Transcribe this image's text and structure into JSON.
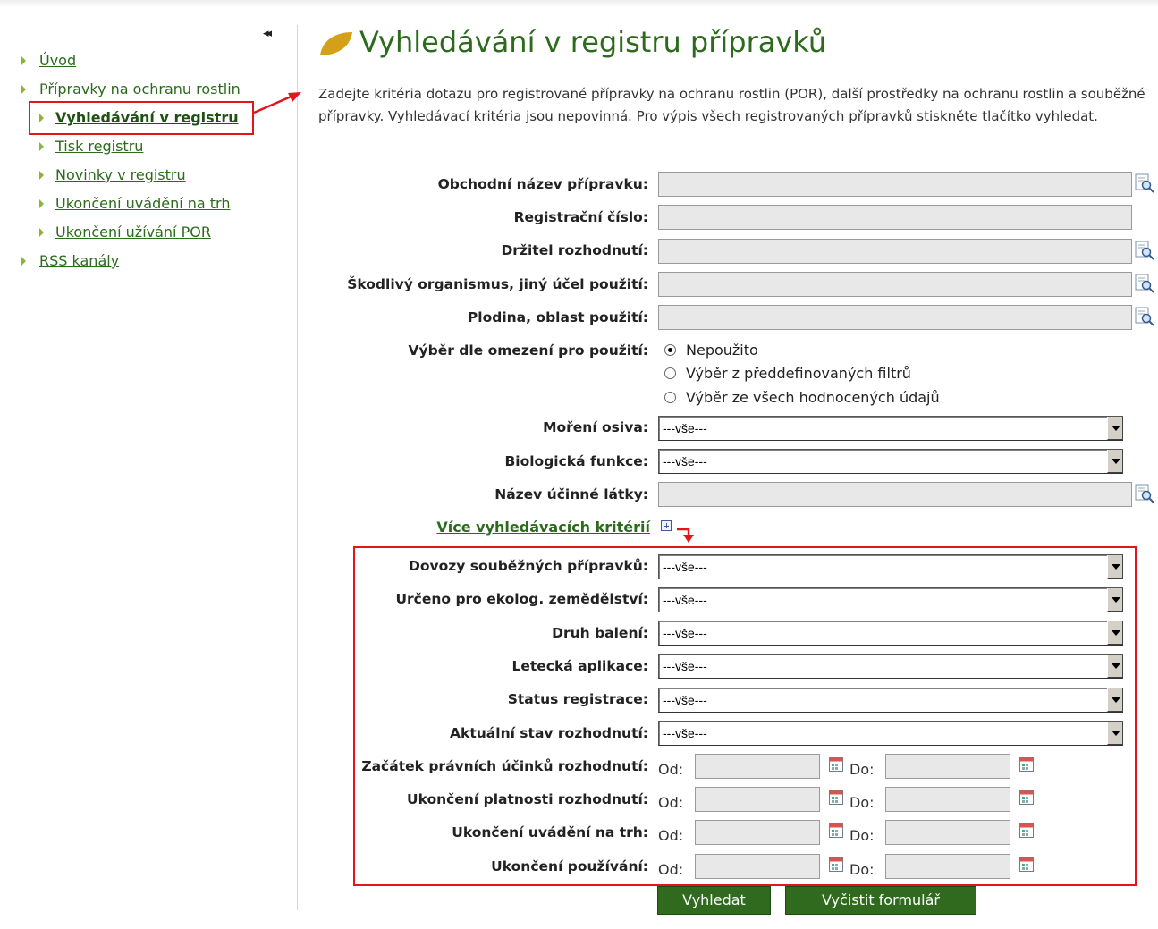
{
  "sidebar": {
    "collapse_icon": "double-chevron-left-icon",
    "collapse_glyph": "◂◂",
    "items": [
      {
        "label": "Úvod"
      },
      {
        "label": "Přípravky na ochranu rostlin"
      },
      {
        "label": "Vyhledávání v registru"
      },
      {
        "label": "Tisk registru"
      },
      {
        "label": "Novinky v registru"
      },
      {
        "label": "Ukončení uvádění na trh"
      },
      {
        "label": "Ukončení užívání POR"
      },
      {
        "label": "RSS kanály"
      }
    ]
  },
  "page": {
    "title": "Vyhledávání v registru přípravků",
    "intro": "Zadejte kritéria dotazu pro registrované přípravky na ochranu rostlin (POR), další prostředky na ochranu rostlin a souběžné přípravky. Vyhledávací kritéria jsou nepovinná. Pro výpis všech registrovaných přípravků stiskněte tlačítko vyhledat."
  },
  "form": {
    "obchodni_nazev": {
      "label": "Obchodní název přípravku:",
      "value": ""
    },
    "registracni_cislo": {
      "label": "Registrační číslo:",
      "value": ""
    },
    "drzitel": {
      "label": "Držitel rozhodnutí:",
      "value": ""
    },
    "skodlivy": {
      "label": "Škodlivý organismus, jiný účel použití:",
      "value": ""
    },
    "plodina": {
      "label": "Plodina, oblast použití:",
      "value": ""
    },
    "omezeni": {
      "label": "Výběr dle omezení pro použití:",
      "options": [
        "Nepoužito",
        "Výběr z předdefinovaných filtrů",
        "Výběr ze všech hodnocených údajů"
      ],
      "selected": "Nepoužito"
    },
    "moreni": {
      "label": "Moření osiva:",
      "value": "---vše---"
    },
    "biologicka": {
      "label": "Biologická funkce:",
      "value": "---vše---"
    },
    "ucinna_latka": {
      "label": "Název účinné látky:",
      "value": ""
    },
    "more_link": "Více vyhledávacích kritérií",
    "dovozy": {
      "label": "Dovozy souběžných přípravků:",
      "value": "---vše---"
    },
    "ekolog": {
      "label": "Určeno pro ekolog. zemědělství:",
      "value": "---vše---"
    },
    "baleni": {
      "label": "Druh balení:",
      "value": "---vše---"
    },
    "letecka": {
      "label": "Letecká aplikace:",
      "value": "---vše---"
    },
    "status": {
      "label": "Status registrace:",
      "value": "---vše---"
    },
    "stav": {
      "label": "Aktuální stav rozhodnutí:",
      "value": "---vše---"
    },
    "date_from": "Od:",
    "date_to": "Do:",
    "zacatek": {
      "label": "Začátek právních účinků rozhodnutí:"
    },
    "platnost": {
      "label": "Ukončení platnosti rozhodnutí:"
    },
    "trh": {
      "label": "Ukončení uvádění na trh:"
    },
    "pouzivani": {
      "label": "Ukončení používání:"
    },
    "search_button": "Vyhledat",
    "clear_button": "Vyčistit formulář"
  },
  "colors": {
    "accent_green": "#2c6b1c",
    "button_green": "#2f6a1e",
    "annotation_red": "#e3141c",
    "leaf": "#d4a017"
  }
}
